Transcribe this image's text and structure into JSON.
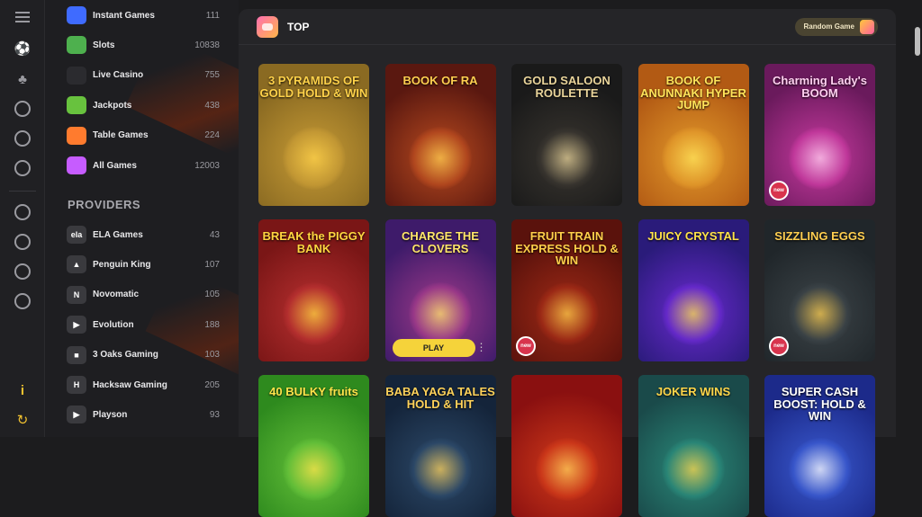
{
  "nav": [
    {
      "label": "Instant Games",
      "count": "111",
      "color": "#3f6bff"
    },
    {
      "label": "Slots",
      "count": "10838",
      "color": "#4eb04e"
    },
    {
      "label": "Live Casino",
      "count": "755",
      "color": "#2b2b2f"
    },
    {
      "label": "Jackpots",
      "count": "438",
      "color": "#68c23e"
    },
    {
      "label": "Table Games",
      "count": "224",
      "color": "#ff7b2e"
    },
    {
      "label": "All Games",
      "count": "12003",
      "color": "#c65cff"
    }
  ],
  "providers_title": "PROVIDERS",
  "providers": [
    {
      "label": "ELA Games",
      "count": "43",
      "icon": "ela"
    },
    {
      "label": "Penguin King",
      "count": "107",
      "icon": "▲"
    },
    {
      "label": "Novomatic",
      "count": "105",
      "icon": "N"
    },
    {
      "label": "Evolution",
      "count": "188",
      "icon": "▶"
    },
    {
      "label": "3 Oaks Gaming",
      "count": "103",
      "icon": "■"
    },
    {
      "label": "Hacksaw Gaming",
      "count": "205",
      "icon": "H"
    },
    {
      "label": "Playson",
      "count": "93",
      "icon": "▶"
    }
  ],
  "main": {
    "title": "TOP",
    "random_label": "Random Game"
  },
  "games": [
    {
      "title": "3 PYRAMIDS OF GOLD HOLD & WIN",
      "bg": "#8a6a22",
      "bg2": "#c79b35",
      "tc": "#ffd24a",
      "new": false
    },
    {
      "title": "BOOK OF RA",
      "bg": "#5a1810",
      "bg2": "#b84a1f",
      "tc": "#ffcf50",
      "new": false
    },
    {
      "title": "GOLD SALOON ROULETTE",
      "bg": "#1a1a1a",
      "bg2": "#3a3630",
      "tc": "#e9d49a",
      "new": false
    },
    {
      "title": "BOOK OF ANUNNAKI HYPER JUMP",
      "bg": "#b25a14",
      "bg2": "#e39a2b",
      "tc": "#ffe45a",
      "new": false
    },
    {
      "title": "Charming Lady's BOOM",
      "bg": "#6a1a5c",
      "bg2": "#c83aa0",
      "tc": "#ffd0f0",
      "new": true
    },
    {
      "title": "BREAK the PIGGY BANK",
      "bg": "#7a1616",
      "bg2": "#b83030",
      "tc": "#ffd640",
      "new": false
    },
    {
      "title": "CHARGE THE CLOVERS",
      "bg": "#3e1b6a",
      "bg2": "#a03a8a",
      "tc": "#ffe66a",
      "new": false
    },
    {
      "title": "FRUIT TRAIN EXPRESS HOLD & WIN",
      "bg": "#5a120c",
      "bg2": "#a02a16",
      "tc": "#ffcf4a",
      "new": true
    },
    {
      "title": "JUICY CRYSTAL",
      "bg": "#2a1b7a",
      "bg2": "#6a2ad0",
      "tc": "#ffe24a",
      "new": false
    },
    {
      "title": "SIZZLING EGGS",
      "bg": "#20262a",
      "bg2": "#3c4448",
      "tc": "#ffcf50",
      "new": true
    },
    {
      "title": "40 BULKY fruits",
      "bg": "#2e8a1e",
      "bg2": "#66c23a",
      "tc": "#ffe44a",
      "new": false
    },
    {
      "title": "BABA YAGA TALES HOLD & HIT",
      "bg": "#14243a",
      "bg2": "#2d4a6a",
      "tc": "#ffd25a",
      "new": false
    },
    {
      "title": "",
      "bg": "#8a1010",
      "bg2": "#d03a1a",
      "tc": "#ffd25a",
      "new": false
    },
    {
      "title": "JOKER WINS",
      "bg": "#1a4a4a",
      "bg2": "#2a8a7a",
      "tc": "#ffd64a",
      "new": false
    },
    {
      "title": "SUPER CASH BOOST: HOLD & WIN",
      "bg": "#1c2a8a",
      "bg2": "#3a5ad0",
      "tc": "#ffffff",
      "new": false
    }
  ],
  "play_label": "PLAY",
  "new_label": "new"
}
